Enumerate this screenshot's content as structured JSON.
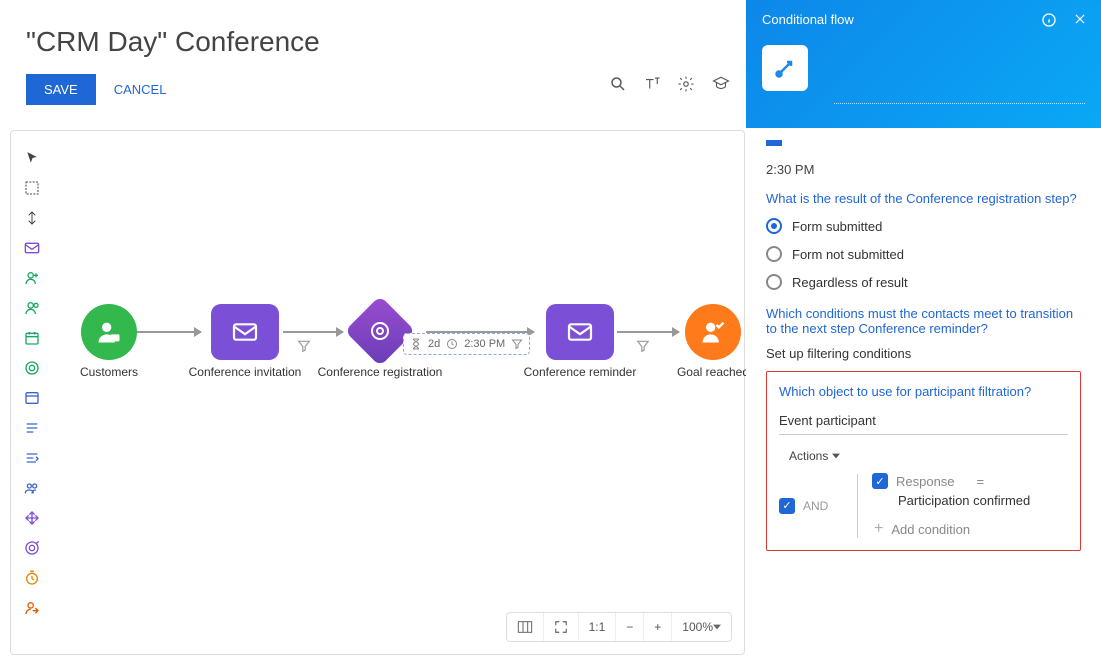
{
  "header": {
    "title": "\"CRM Day\" Conference",
    "save_label": "SAVE",
    "cancel_label": "CANCEL"
  },
  "canvas": {
    "nodes": {
      "customers": "Customers",
      "invitation": "Conference invitation",
      "registration": "Conference registration",
      "reminder": "Conference reminder",
      "goal": "Goal reached"
    },
    "delayBox": {
      "days": "2d",
      "time": "2:30 PM"
    }
  },
  "zoom": {
    "scale": "1:1",
    "percent": "100%"
  },
  "panel": {
    "title": "Conditional flow",
    "time": "2:30 PM",
    "q1": "What is the result of the Conference registration step?",
    "options": {
      "o1": "Form submitted",
      "o2": "Form not submitted",
      "o3": "Regardless of result"
    },
    "q2": "Which conditions must the contacts meet to transition to the next step Conference reminder?",
    "filter_note": "Set up filtering conditions",
    "q3": "Which object to use for participant filtration?",
    "object_value": "Event participant",
    "actions_label": "Actions",
    "and_label": "AND",
    "cond": {
      "field": "Response",
      "op": "=",
      "value": "Participation confirmed"
    },
    "add_condition": "Add condition"
  }
}
